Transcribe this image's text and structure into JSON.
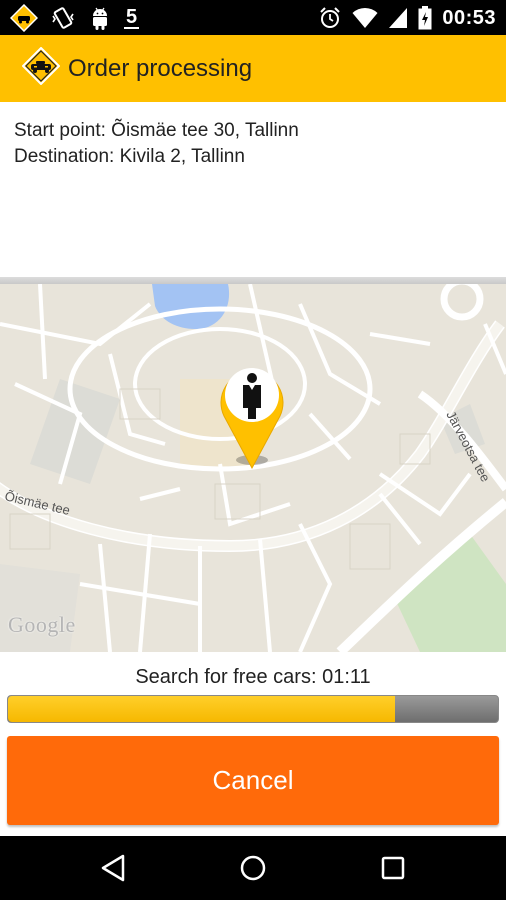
{
  "status_bar": {
    "time": "00:53",
    "notification_count": "5",
    "icons": [
      "taxi-app-icon",
      "vibrate-icon",
      "android-icon",
      "alarm-icon",
      "wifi-icon",
      "signal-icon",
      "battery-charging-icon"
    ]
  },
  "app_bar": {
    "title": "Order processing",
    "background": "#ffc000"
  },
  "order": {
    "start_point": "Start point: Õismäe tee 30, Tallinn",
    "destination": "Destination: Kivila 2, Tallinn"
  },
  "map": {
    "street_labels": {
      "oismae": "Õismäe tee",
      "jarveotsa": "Järveotsa tee"
    },
    "attribution": "Google",
    "marker_icon": "person-pin-icon"
  },
  "search": {
    "label": "Search for free cars: 01:11",
    "progress_fraction": 0.79,
    "progress_color": "#ffc000"
  },
  "actions": {
    "cancel_label": "Cancel",
    "cancel_color": "#ff6a0a"
  },
  "nav_bar": {
    "icons": [
      "back-icon",
      "home-icon",
      "recents-icon"
    ]
  }
}
